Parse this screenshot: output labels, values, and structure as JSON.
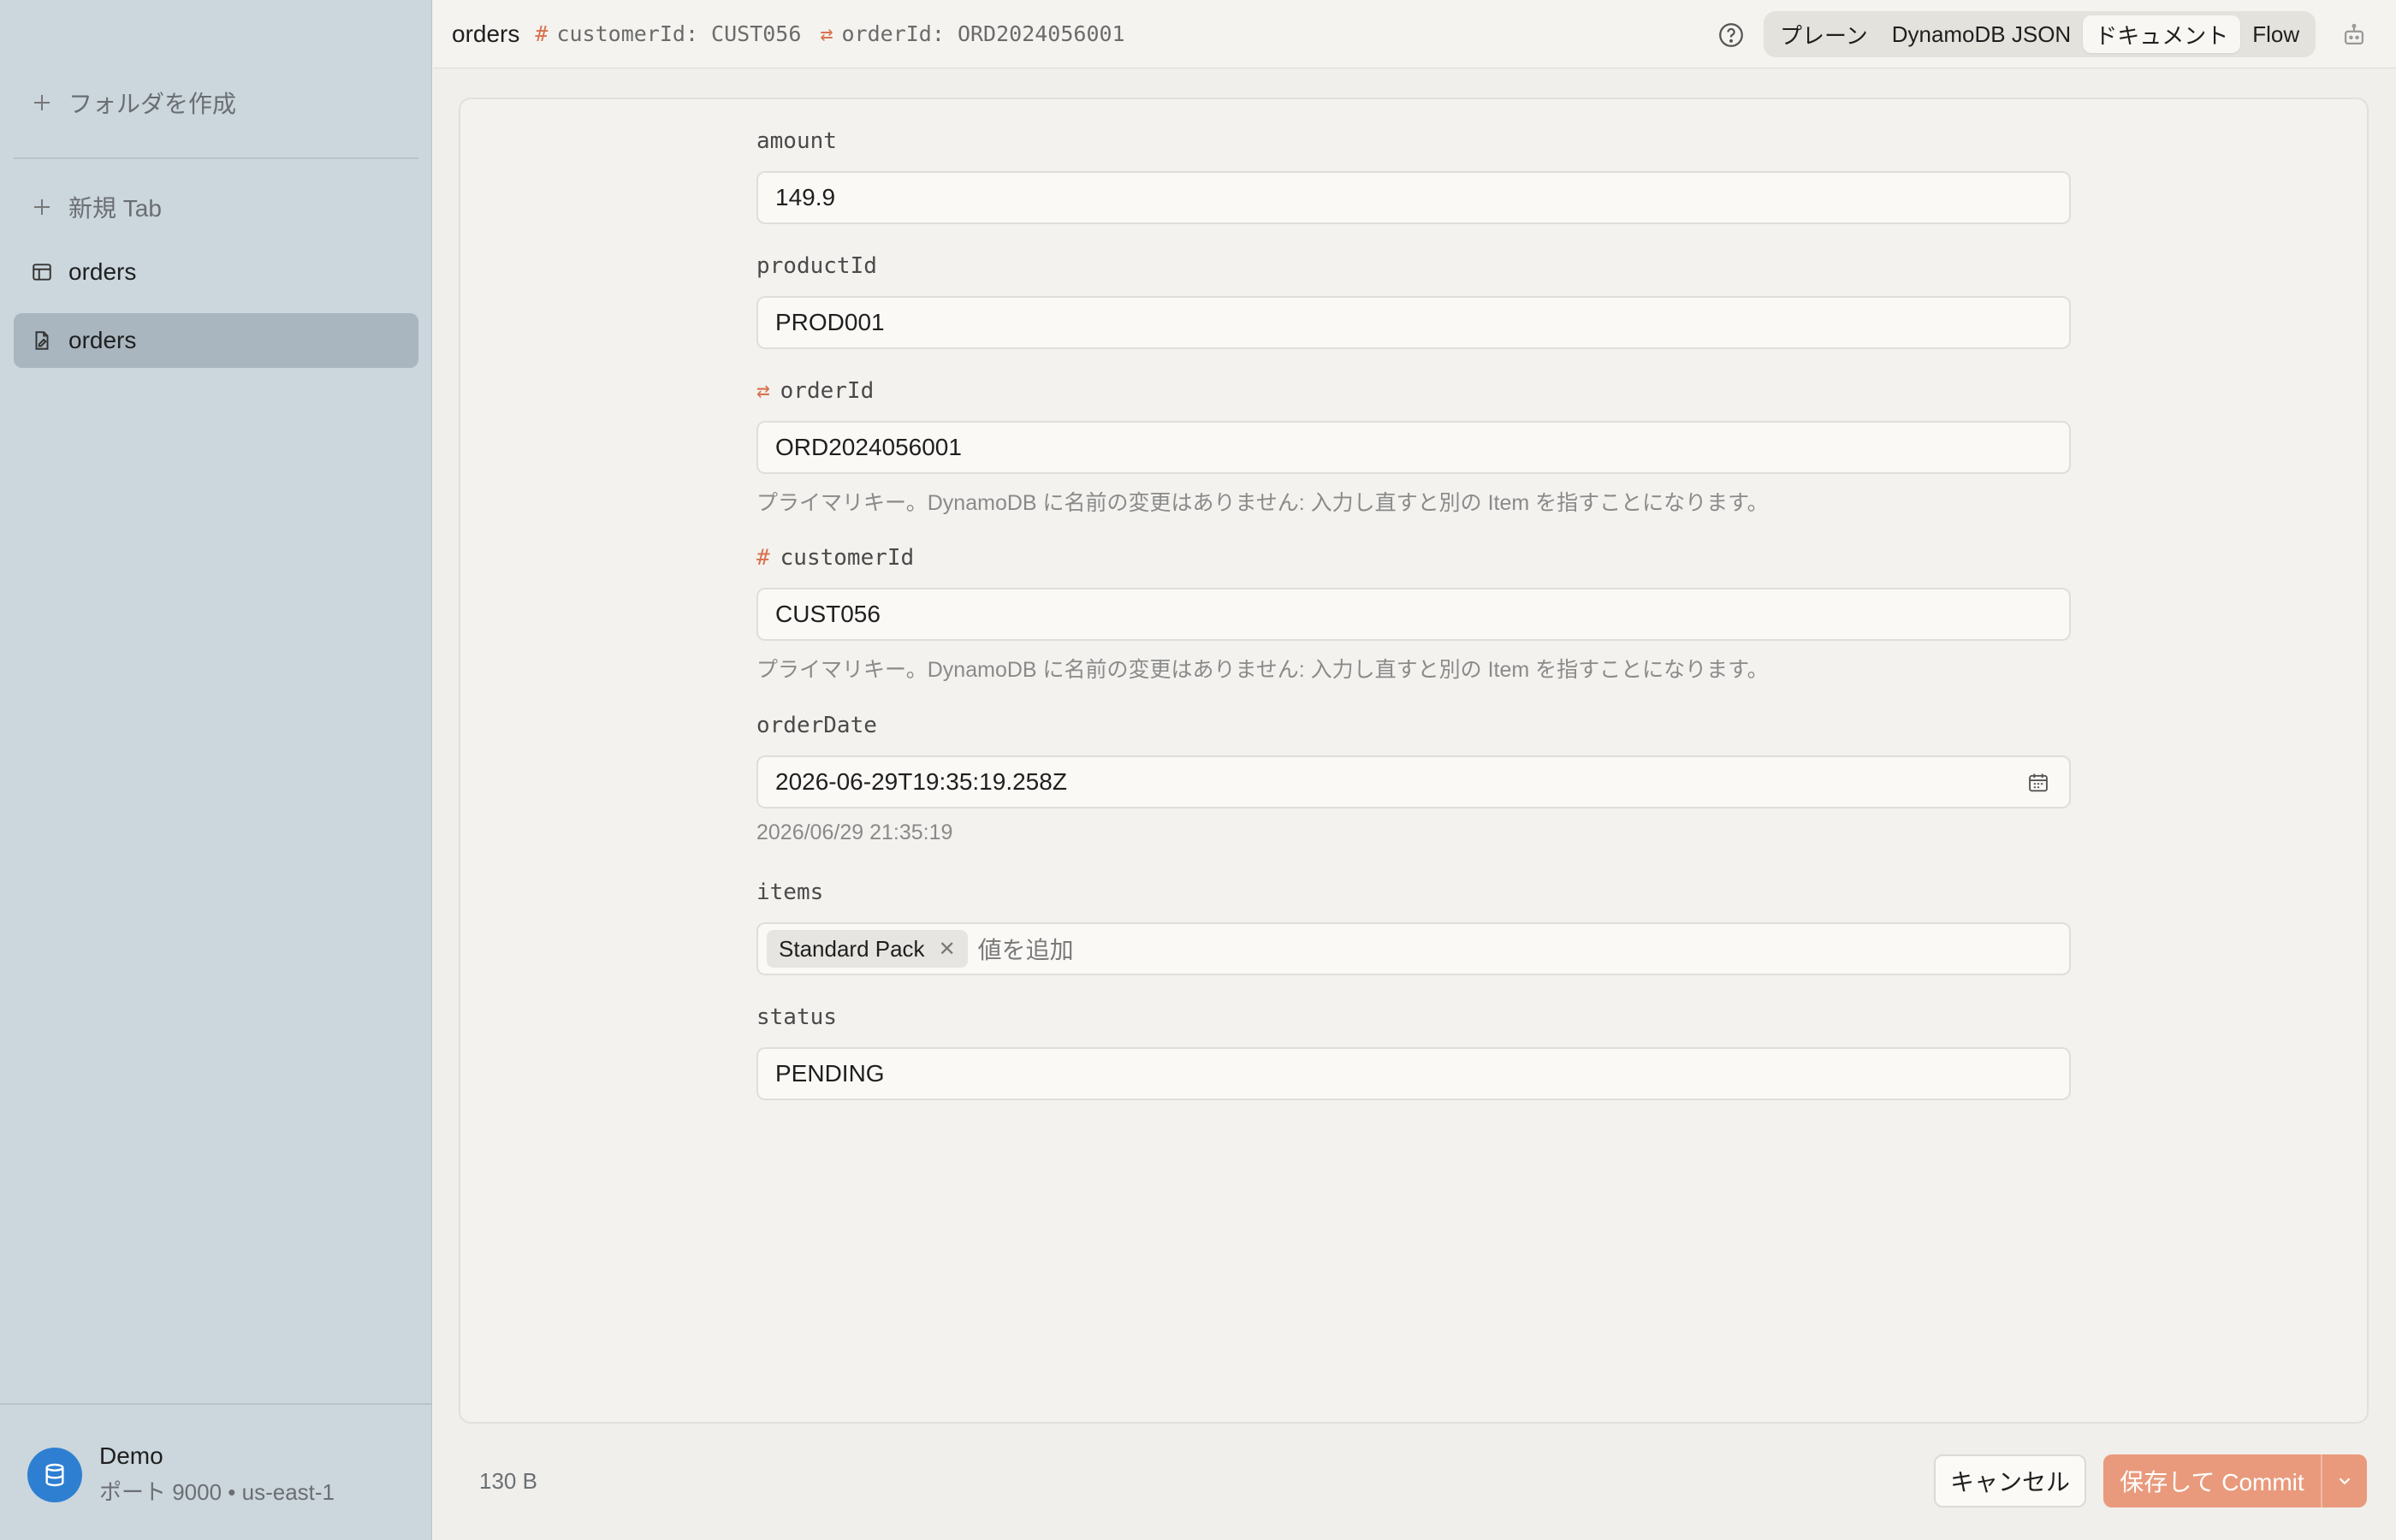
{
  "sidebar": {
    "create_folder": "フォルダを作成",
    "new_tab": "新規 Tab",
    "items": [
      {
        "label": "orders",
        "icon": "table-icon"
      },
      {
        "label": "orders",
        "icon": "document-edit-icon",
        "active": true
      }
    ],
    "connection": {
      "name": "Demo",
      "details": "ポート 9000 • us-east-1"
    }
  },
  "header": {
    "title": "orders",
    "keys": [
      {
        "symbol": "#",
        "text": "customerId: CUST056"
      },
      {
        "symbol": "⇄",
        "text": "orderId: ORD2024056001"
      }
    ],
    "view_modes": [
      "プレーン",
      "DynamoDB JSON",
      "ドキュメント",
      "Flow"
    ],
    "active_view": "ドキュメント"
  },
  "form": {
    "amount": {
      "label": "amount",
      "value": "149.9"
    },
    "productId": {
      "label": "productId",
      "value": "PROD001"
    },
    "orderId": {
      "label": "orderId",
      "symbol": "⇄",
      "value": "ORD2024056001",
      "help": "プライマリキー。DynamoDB に名前の変更はありません: 入力し直すと別の Item を指すことになります。"
    },
    "customerId": {
      "label": "customerId",
      "symbol": "#",
      "value": "CUST056",
      "help": "プライマリキー。DynamoDB に名前の変更はありません: 入力し直すと別の Item を指すことになります。"
    },
    "orderDate": {
      "label": "orderDate",
      "value": "2026-06-29T19:35:19.258Z",
      "local": "2026/06/29 21:35:19"
    },
    "items": {
      "label": "items",
      "chips": [
        "Standard Pack"
      ],
      "placeholder": "値を追加"
    },
    "status": {
      "label": "status",
      "value": "PENDING"
    }
  },
  "footer": {
    "size": "130 B",
    "cancel": "キャンセル",
    "commit": "保存して Commit"
  },
  "colors": {
    "sidebar_bg": "#cbd6dd",
    "accent_key": "#d9714e",
    "commit_button": "#e99a7c",
    "connection_avatar": "#2e7fd1"
  }
}
